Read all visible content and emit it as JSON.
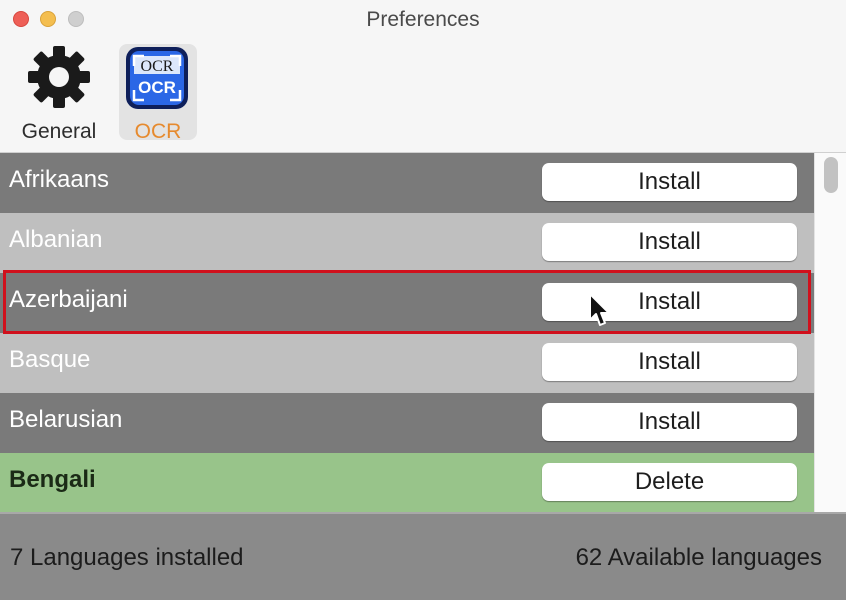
{
  "window": {
    "title": "Preferences"
  },
  "toolbar": {
    "general": {
      "label": "General",
      "icon": "gear-icon"
    },
    "ocr": {
      "label": "OCR",
      "icon": "ocr-icon",
      "icon_text_top": "OCR",
      "icon_text_bottom": "OCR",
      "selected": true
    }
  },
  "languages": [
    {
      "name": "Afrikaans",
      "action": "Install"
    },
    {
      "name": "Albanian",
      "action": "Install"
    },
    {
      "name": "Azerbaijani",
      "action": "Install"
    },
    {
      "name": "Basque",
      "action": "Install"
    },
    {
      "name": "Belarusian",
      "action": "Install"
    },
    {
      "name": "Bengali",
      "action": "Delete"
    }
  ],
  "footer": {
    "installed": "7 Languages installed",
    "available": "62 Available languages"
  },
  "colors": {
    "row_dark": "#7a7a7a",
    "row_light": "#bfbfbf",
    "row_installed": "#98c48a",
    "highlight": "#d0101c",
    "ocr_label": "#e68a2e"
  }
}
